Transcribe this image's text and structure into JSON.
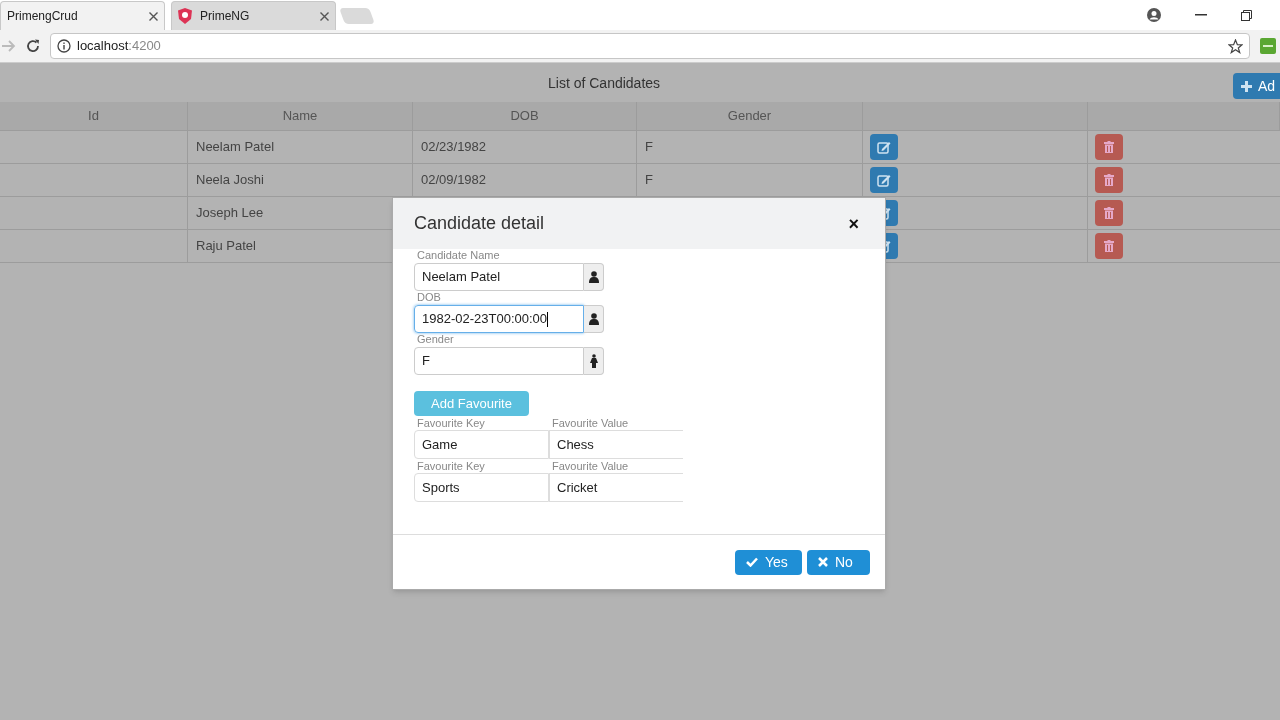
{
  "browser": {
    "tabs": [
      {
        "title": "PrimengCrud",
        "selected": true
      },
      {
        "title": "PrimeNG",
        "selected": false
      }
    ],
    "address": {
      "host": "localhost",
      "port": ":4200"
    }
  },
  "page": {
    "title": "List of Candidates",
    "add_button": "Ad",
    "table": {
      "columns": [
        "Id",
        "Name",
        "DOB",
        "Gender"
      ],
      "rows": [
        {
          "name": "Neelam Patel",
          "dob": "02/23/1982",
          "gender": "F"
        },
        {
          "name": "Neela Joshi",
          "dob": "02/09/1982",
          "gender": "F"
        },
        {
          "name": "Joseph Lee"
        },
        {
          "name": "Raju Patel"
        }
      ]
    }
  },
  "dialog": {
    "title": "Candidate detail",
    "close": "×",
    "fields": [
      {
        "label": "Candidate Name",
        "value": "Neelam Patel",
        "focused": false,
        "kind": "person"
      },
      {
        "label": "DOB",
        "value": "1982-02-23T00:00:00",
        "focused": true,
        "kind": "person"
      },
      {
        "label": "Gender",
        "value": "F",
        "focused": false,
        "kind": "gender"
      }
    ],
    "add_button": "Add Favourite",
    "favourites": [
      {
        "key_label": "Favourite Key",
        "key": "Game",
        "value_label": "Favourite Value",
        "value": "Chess"
      },
      {
        "key_label": "Favourite Key",
        "key": "Sports",
        "value_label": "Favourite Value",
        "value": "Cricket"
      }
    ],
    "buttons": [
      {
        "label": "Yes",
        "kind": "yes"
      },
      {
        "label": "No",
        "kind": "no"
      }
    ]
  }
}
